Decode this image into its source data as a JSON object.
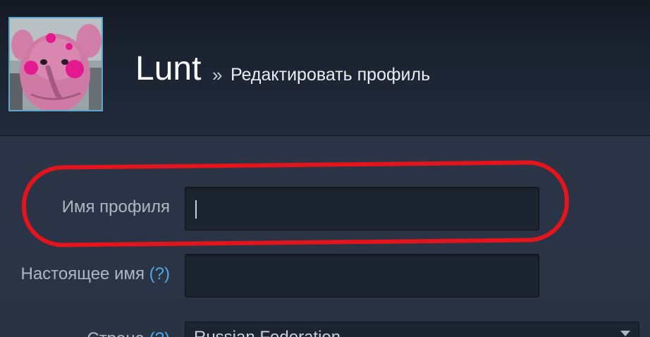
{
  "profile": {
    "username": "Lunt",
    "breadcrumb_separator": "»",
    "page_title": "Редактировать профиль",
    "avatar_icon": "profile-avatar-icon"
  },
  "form": {
    "profile_name": {
      "label": "Имя профиля",
      "value": ""
    },
    "real_name": {
      "label": "Настоящее имя",
      "help": "(?)",
      "value": ""
    },
    "country": {
      "label": "Страна",
      "help": "(?)",
      "selected": "Russian Federation"
    }
  },
  "colors": {
    "highlight": "#e3141b",
    "help_link": "#4fa9e6",
    "input_bg": "#1d2431"
  }
}
